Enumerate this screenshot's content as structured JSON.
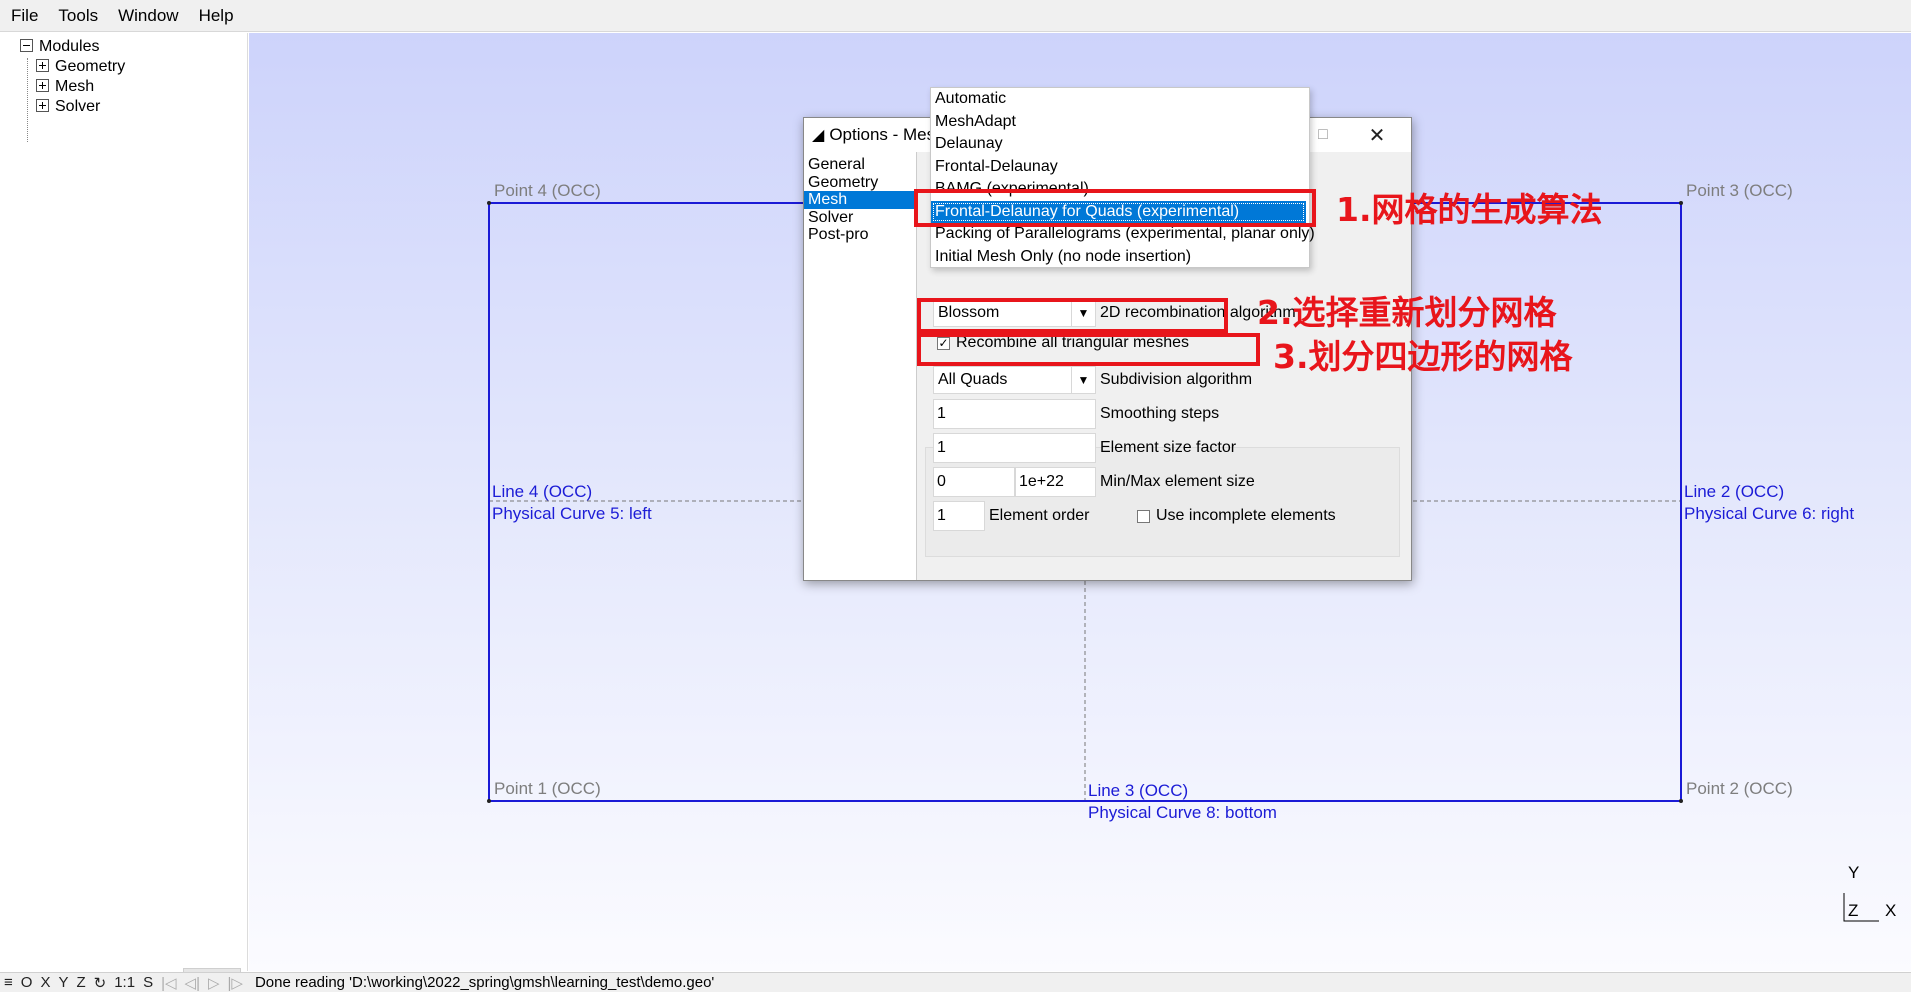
{
  "menu": [
    "File",
    "Tools",
    "Window",
    "Help"
  ],
  "tree": {
    "root": "Modules",
    "children": [
      "Geometry",
      "Mesh",
      "Solver"
    ]
  },
  "canvas": {
    "points": {
      "p4": "Point 4 (OCC)",
      "p3": "Point 3 (OCC)",
      "p1": "Point 1 (OCC)",
      "p2": "Point 2 (OCC)"
    },
    "lines": {
      "left_name": "Line 4 (OCC)",
      "left_phys": "Physical Curve 5: left",
      "right_name": "Line 2 (OCC)",
      "right_phys": "Physical Curve 6: right",
      "bottom_name": "Line 3 (OCC)",
      "bottom_phys": "Physical Curve 8: bottom"
    },
    "axes": {
      "y": "Y",
      "z": "Z",
      "x": "X"
    },
    "colors": {
      "geometry_line": "#1a1ad6",
      "point_label": "#7e7e7e",
      "background_top": "#cdd3fb",
      "background_bottom": "#fbfbff"
    }
  },
  "status": {
    "buttons": [
      "≡",
      "O",
      "X",
      "Y",
      "Z",
      "↻",
      "1:1",
      "S"
    ],
    "message": "Done reading 'D:\\working\\2022_spring\\gmsh\\learning_test\\demo.geo'"
  },
  "dialog": {
    "title": "Options - Mes",
    "categories": [
      "General",
      "Geometry",
      "Mesh",
      "Solver",
      "Post-pro"
    ],
    "selected_category": "Mesh",
    "recomb_value": "Blossom",
    "recomb_label": "2D recombination algorithm",
    "recombine_all_label": "Recombine all triangular meshes",
    "recombine_all_checked": true,
    "subdivision_value": "All Quads",
    "subdivision_label": "Subdivision algorithm",
    "smoothing_value": "1",
    "smoothing_label": "Smoothing steps",
    "size_factor_value": "1",
    "size_factor_label": "Element size factor",
    "min_size": "0",
    "max_size": "1e+22",
    "minmax_label": "Min/Max element size",
    "order_value": "1",
    "order_label": "Element order",
    "incomplete_label": "Use incomplete elements",
    "incomplete_checked": false
  },
  "algorithm_dropdown": {
    "options": [
      "Automatic",
      "MeshAdapt",
      "Delaunay",
      "Frontal-Delaunay",
      "BAMG (experimental)",
      "Frontal-Delaunay for Quads (experimental)",
      "Packing of Parallelograms (experimental, planar only)",
      "Initial Mesh Only (no node insertion)"
    ],
    "selected": "Frontal-Delaunay for Quads (experimental)"
  },
  "annotations": {
    "a1": "1.网格的生成算法",
    "a2": "2.选择重新划分网格",
    "a3": "3.划分四边形的网格",
    "color": "#e8151b"
  }
}
